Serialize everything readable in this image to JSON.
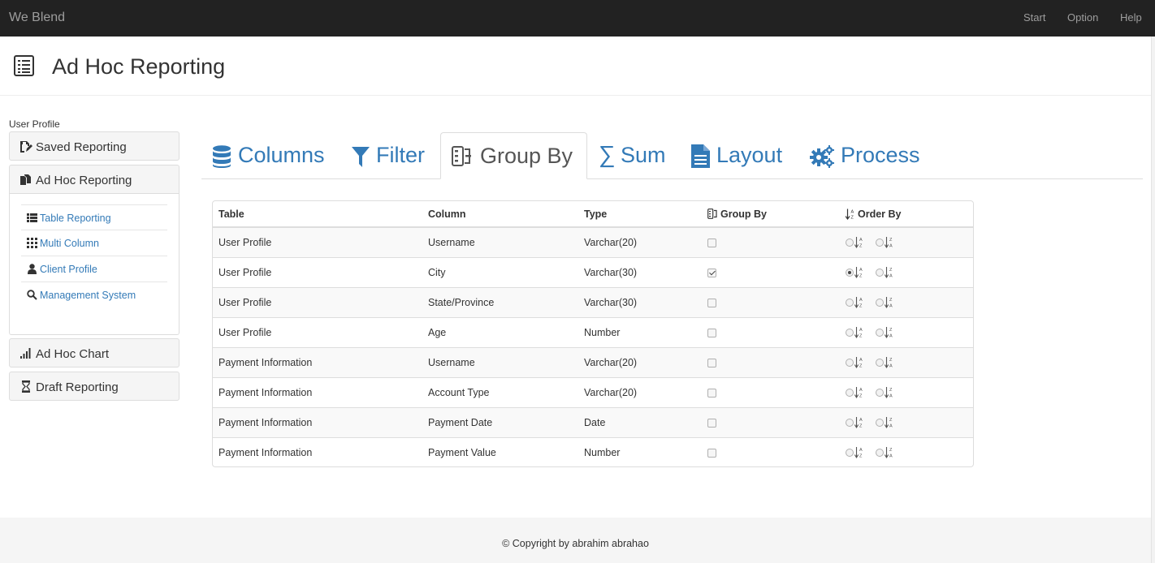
{
  "navbar": {
    "brand": "We Blend",
    "links": [
      "Start",
      "Option",
      "Help"
    ]
  },
  "header": {
    "icon": "list-alt-icon",
    "title": "Ad Hoc Reporting"
  },
  "sidebar": {
    "caption": "User Profile",
    "panels": [
      {
        "label": "Saved Reporting",
        "icon": "saved-reporting-icon"
      },
      {
        "label": "Ad Hoc Reporting",
        "icon": "files-icon"
      },
      {
        "label": "Ad Hoc Chart",
        "icon": "signal-icon"
      },
      {
        "label": "Draft Reporting",
        "icon": "hourglass-icon"
      }
    ],
    "sub_items": [
      {
        "label": "Table Reporting",
        "icon": "th-list-icon"
      },
      {
        "label": "Multi Column",
        "icon": "th-icon"
      },
      {
        "label": "Client Profile",
        "icon": "user-icon"
      },
      {
        "label": "Management System",
        "icon": "search-icon"
      }
    ]
  },
  "tabs": [
    {
      "label": "Columns",
      "icon": "database-icon"
    },
    {
      "label": "Filter",
      "icon": "filter-icon"
    },
    {
      "label": "Group By",
      "icon": "group-icon",
      "active": true
    },
    {
      "label": "Sum",
      "icon": "sum-icon"
    },
    {
      "label": "Layout",
      "icon": "document-icon"
    },
    {
      "label": "Process",
      "icon": "cogs-icon"
    }
  ],
  "table": {
    "headers": [
      "Table",
      "Column",
      "Type",
      "Group By",
      "Order By"
    ],
    "rows": [
      {
        "table": "User Profile",
        "column": "Username",
        "type": "Varchar(20)",
        "group_by": false,
        "order": ""
      },
      {
        "table": "User Profile",
        "column": "City",
        "type": "Varchar(30)",
        "group_by": true,
        "order": "asc"
      },
      {
        "table": "User Profile",
        "column": "State/Province",
        "type": "Varchar(30)",
        "group_by": false,
        "order": ""
      },
      {
        "table": "User Profile",
        "column": "Age",
        "type": "Number",
        "group_by": false,
        "order": ""
      },
      {
        "table": "Payment Information",
        "column": "Username",
        "type": "Varchar(20)",
        "group_by": false,
        "order": ""
      },
      {
        "table": "Payment Information",
        "column": "Account Type",
        "type": "Varchar(20)",
        "group_by": false,
        "order": ""
      },
      {
        "table": "Payment Information",
        "column": "Payment Date",
        "type": "Date",
        "group_by": false,
        "order": ""
      },
      {
        "table": "Payment Information",
        "column": "Payment Value",
        "type": "Number",
        "group_by": false,
        "order": ""
      }
    ]
  },
  "footer": {
    "text": "© Copyright by abrahim abrahao"
  },
  "colors": {
    "navbar": "#222222",
    "link": "#337ab7",
    "footer_bg": "#f5f5f5"
  }
}
